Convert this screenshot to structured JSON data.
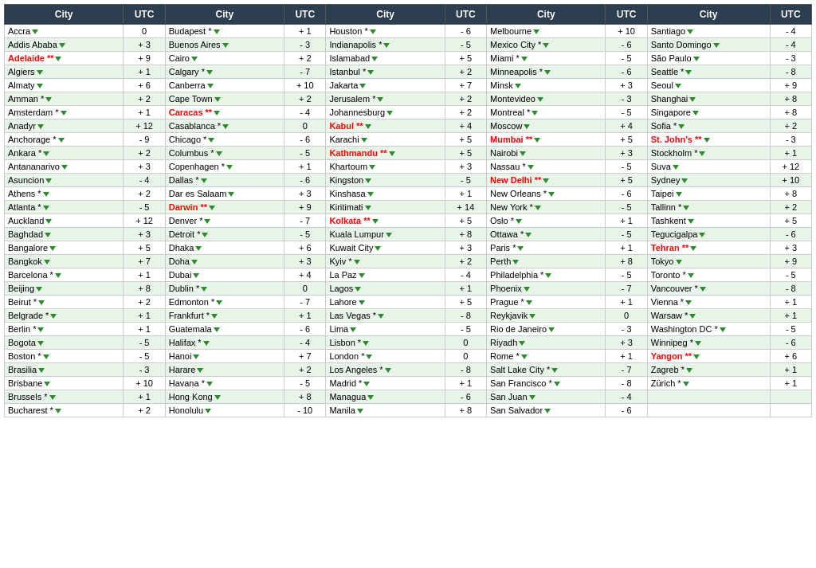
{
  "headers": [
    {
      "col1": "City",
      "col2": "UTC",
      "col3": "City",
      "col4": "UTC",
      "col5": "City",
      "col6": "UTC",
      "col7": "City",
      "col8": "UTC",
      "col9": "City",
      "col10": "UTC"
    }
  ],
  "rows": [
    [
      {
        "name": "Accra",
        "utc": "0",
        "red": false
      },
      {
        "name": "Budapest *",
        "utc": "+ 1",
        "red": false
      },
      {
        "name": "Houston *",
        "utc": "- 6",
        "red": false
      },
      {
        "name": "Melbourne",
        "utc": "+ 10",
        "red": false
      },
      {
        "name": "Santiago",
        "utc": "- 4",
        "red": false
      }
    ],
    [
      {
        "name": "Addis Ababa",
        "utc": "+ 3",
        "red": false
      },
      {
        "name": "Buenos Aires",
        "utc": "- 3",
        "red": false
      },
      {
        "name": "Indianapolis *",
        "utc": "- 5",
        "red": false
      },
      {
        "name": "Mexico City *",
        "utc": "- 6",
        "red": false
      },
      {
        "name": "Santo Domingo",
        "utc": "- 4",
        "red": false
      }
    ],
    [
      {
        "name": "Adelaide **",
        "utc": "+ 9",
        "red": true
      },
      {
        "name": "Cairo",
        "utc": "+ 2",
        "red": false
      },
      {
        "name": "Islamabad",
        "utc": "+ 5",
        "red": false
      },
      {
        "name": "Miami *",
        "utc": "- 5",
        "red": false
      },
      {
        "name": "São Paulo",
        "utc": "- 3",
        "red": false
      }
    ],
    [
      {
        "name": "Algiers",
        "utc": "+ 1",
        "red": false
      },
      {
        "name": "Calgary *",
        "utc": "- 7",
        "red": false
      },
      {
        "name": "Istanbul *",
        "utc": "+ 2",
        "red": false
      },
      {
        "name": "Minneapolis *",
        "utc": "- 6",
        "red": false
      },
      {
        "name": "Seattle *",
        "utc": "- 8",
        "red": false
      }
    ],
    [
      {
        "name": "Almaty",
        "utc": "+ 6",
        "red": false
      },
      {
        "name": "Canberra",
        "utc": "+ 10",
        "red": false
      },
      {
        "name": "Jakarta",
        "utc": "+ 7",
        "red": false
      },
      {
        "name": "Minsk",
        "utc": "+ 3",
        "red": false
      },
      {
        "name": "Seoul",
        "utc": "+ 9",
        "red": false
      }
    ],
    [
      {
        "name": "Amman *",
        "utc": "+ 2",
        "red": false
      },
      {
        "name": "Cape Town",
        "utc": "+ 2",
        "red": false
      },
      {
        "name": "Jerusalem *",
        "utc": "+ 2",
        "red": false
      },
      {
        "name": "Montevideo",
        "utc": "- 3",
        "red": false
      },
      {
        "name": "Shanghai",
        "utc": "+ 8",
        "red": false
      }
    ],
    [
      {
        "name": "Amsterdam *",
        "utc": "+ 1",
        "red": false
      },
      {
        "name": "Caracas **",
        "utc": "- 4",
        "red": true
      },
      {
        "name": "Johannesburg",
        "utc": "+ 2",
        "red": false
      },
      {
        "name": "Montreal *",
        "utc": "- 5",
        "red": false
      },
      {
        "name": "Singapore",
        "utc": "+ 8",
        "red": false
      }
    ],
    [
      {
        "name": "Anadyr",
        "utc": "+ 12",
        "red": false
      },
      {
        "name": "Casablanca *",
        "utc": "0",
        "red": false
      },
      {
        "name": "Kabul **",
        "utc": "+ 4",
        "red": true
      },
      {
        "name": "Moscow",
        "utc": "+ 4",
        "red": false
      },
      {
        "name": "Sofia *",
        "utc": "+ 2",
        "red": false
      }
    ],
    [
      {
        "name": "Anchorage *",
        "utc": "- 9",
        "red": false
      },
      {
        "name": "Chicago *",
        "utc": "- 6",
        "red": false
      },
      {
        "name": "Karachi",
        "utc": "+ 5",
        "red": false
      },
      {
        "name": "Mumbai **",
        "utc": "+ 5",
        "red": true
      },
      {
        "name": "St. John's **",
        "utc": "- 3",
        "red": true
      }
    ],
    [
      {
        "name": "Ankara *",
        "utc": "+ 2",
        "red": false
      },
      {
        "name": "Columbus *",
        "utc": "- 5",
        "red": false
      },
      {
        "name": "Kathmandu **",
        "utc": "+ 5",
        "red": true
      },
      {
        "name": "Nairobi",
        "utc": "+ 3",
        "red": false
      },
      {
        "name": "Stockholm *",
        "utc": "+ 1",
        "red": false
      }
    ],
    [
      {
        "name": "Antananarivo",
        "utc": "+ 3",
        "red": false
      },
      {
        "name": "Copenhagen *",
        "utc": "+ 1",
        "red": false
      },
      {
        "name": "Khartoum",
        "utc": "+ 3",
        "red": false
      },
      {
        "name": "Nassau *",
        "utc": "- 5",
        "red": false
      },
      {
        "name": "Suva",
        "utc": "+ 12",
        "red": false
      }
    ],
    [
      {
        "name": "Asuncion",
        "utc": "- 4",
        "red": false
      },
      {
        "name": "Dallas *",
        "utc": "- 6",
        "red": false
      },
      {
        "name": "Kingston",
        "utc": "- 5",
        "red": false
      },
      {
        "name": "New Delhi **",
        "utc": "+ 5",
        "red": true
      },
      {
        "name": "Sydney",
        "utc": "+ 10",
        "red": false
      }
    ],
    [
      {
        "name": "Athens *",
        "utc": "+ 2",
        "red": false
      },
      {
        "name": "Dar es Salaam",
        "utc": "+ 3",
        "red": false
      },
      {
        "name": "Kinshasa",
        "utc": "+ 1",
        "red": false
      },
      {
        "name": "New Orleans *",
        "utc": "- 6",
        "red": false
      },
      {
        "name": "Taipei",
        "utc": "+ 8",
        "red": false
      }
    ],
    [
      {
        "name": "Atlanta *",
        "utc": "- 5",
        "red": false
      },
      {
        "name": "Darwin **",
        "utc": "+ 9",
        "red": true
      },
      {
        "name": "Kiritimati",
        "utc": "+ 14",
        "red": false
      },
      {
        "name": "New York *",
        "utc": "- 5",
        "red": false
      },
      {
        "name": "Tallinn *",
        "utc": "+ 2",
        "red": false
      }
    ],
    [
      {
        "name": "Auckland",
        "utc": "+ 12",
        "red": false
      },
      {
        "name": "Denver *",
        "utc": "- 7",
        "red": false
      },
      {
        "name": "Kolkata **",
        "utc": "+ 5",
        "red": true
      },
      {
        "name": "Oslo *",
        "utc": "+ 1",
        "red": false
      },
      {
        "name": "Tashkent",
        "utc": "+ 5",
        "red": false
      }
    ],
    [
      {
        "name": "Baghdad",
        "utc": "+ 3",
        "red": false
      },
      {
        "name": "Detroit *",
        "utc": "- 5",
        "red": false
      },
      {
        "name": "Kuala Lumpur",
        "utc": "+ 8",
        "red": false
      },
      {
        "name": "Ottawa *",
        "utc": "- 5",
        "red": false
      },
      {
        "name": "Tegucigalpa",
        "utc": "- 6",
        "red": false
      }
    ],
    [
      {
        "name": "Bangalore",
        "utc": "+ 5",
        "red": false
      },
      {
        "name": "Dhaka",
        "utc": "+ 6",
        "red": false
      },
      {
        "name": "Kuwait City",
        "utc": "+ 3",
        "red": false
      },
      {
        "name": "Paris *",
        "utc": "+ 1",
        "red": false
      },
      {
        "name": "Tehran **",
        "utc": "+ 3",
        "red": true
      }
    ],
    [
      {
        "name": "Bangkok",
        "utc": "+ 7",
        "red": false
      },
      {
        "name": "Doha",
        "utc": "+ 3",
        "red": false
      },
      {
        "name": "Kyiv *",
        "utc": "+ 2",
        "red": false
      },
      {
        "name": "Perth",
        "utc": "+ 8",
        "red": false
      },
      {
        "name": "Tokyo",
        "utc": "+ 9",
        "red": false
      }
    ],
    [
      {
        "name": "Barcelona *",
        "utc": "+ 1",
        "red": false
      },
      {
        "name": "Dubai",
        "utc": "+ 4",
        "red": false
      },
      {
        "name": "La Paz",
        "utc": "- 4",
        "red": false
      },
      {
        "name": "Philadelphia *",
        "utc": "- 5",
        "red": false
      },
      {
        "name": "Toronto *",
        "utc": "- 5",
        "red": false
      }
    ],
    [
      {
        "name": "Beijing",
        "utc": "+ 8",
        "red": false
      },
      {
        "name": "Dublin *",
        "utc": "0",
        "red": false
      },
      {
        "name": "Lagos",
        "utc": "+ 1",
        "red": false
      },
      {
        "name": "Phoenix",
        "utc": "- 7",
        "red": false
      },
      {
        "name": "Vancouver *",
        "utc": "- 8",
        "red": false
      }
    ],
    [
      {
        "name": "Beirut *",
        "utc": "+ 2",
        "red": false
      },
      {
        "name": "Edmonton *",
        "utc": "- 7",
        "red": false
      },
      {
        "name": "Lahore",
        "utc": "+ 5",
        "red": false
      },
      {
        "name": "Prague *",
        "utc": "+ 1",
        "red": false
      },
      {
        "name": "Vienna *",
        "utc": "+ 1",
        "red": false
      }
    ],
    [
      {
        "name": "Belgrade *",
        "utc": "+ 1",
        "red": false
      },
      {
        "name": "Frankfurt *",
        "utc": "+ 1",
        "red": false
      },
      {
        "name": "Las Vegas *",
        "utc": "- 8",
        "red": false
      },
      {
        "name": "Reykjavik",
        "utc": "0",
        "red": false
      },
      {
        "name": "Warsaw *",
        "utc": "+ 1",
        "red": false
      }
    ],
    [
      {
        "name": "Berlin *",
        "utc": "+ 1",
        "red": false
      },
      {
        "name": "Guatemala",
        "utc": "- 6",
        "red": false
      },
      {
        "name": "Lima",
        "utc": "- 5",
        "red": false
      },
      {
        "name": "Rio de Janeiro",
        "utc": "- 3",
        "red": false
      },
      {
        "name": "Washington DC *",
        "utc": "- 5",
        "red": false
      }
    ],
    [
      {
        "name": "Bogota",
        "utc": "- 5",
        "red": false
      },
      {
        "name": "Halifax *",
        "utc": "- 4",
        "red": false
      },
      {
        "name": "Lisbon *",
        "utc": "0",
        "red": false
      },
      {
        "name": "Riyadh",
        "utc": "+ 3",
        "red": false
      },
      {
        "name": "Winnipeg *",
        "utc": "- 6",
        "red": false
      }
    ],
    [
      {
        "name": "Boston *",
        "utc": "- 5",
        "red": false
      },
      {
        "name": "Hanoi",
        "utc": "+ 7",
        "red": false
      },
      {
        "name": "London *",
        "utc": "0",
        "red": false
      },
      {
        "name": "Rome *",
        "utc": "+ 1",
        "red": false
      },
      {
        "name": "Yangon **",
        "utc": "+ 6",
        "red": true
      }
    ],
    [
      {
        "name": "Brasilia",
        "utc": "- 3",
        "red": false
      },
      {
        "name": "Harare",
        "utc": "+ 2",
        "red": false
      },
      {
        "name": "Los Angeles *",
        "utc": "- 8",
        "red": false
      },
      {
        "name": "Salt Lake City *",
        "utc": "- 7",
        "red": false
      },
      {
        "name": "Zagreb *",
        "utc": "+ 1",
        "red": false
      }
    ],
    [
      {
        "name": "Brisbane",
        "utc": "+ 10",
        "red": false
      },
      {
        "name": "Havana *",
        "utc": "- 5",
        "red": false
      },
      {
        "name": "Madrid *",
        "utc": "+ 1",
        "red": false
      },
      {
        "name": "San Francisco *",
        "utc": "- 8",
        "red": false
      },
      {
        "name": "Zürich *",
        "utc": "+ 1",
        "red": false
      }
    ],
    [
      {
        "name": "Brussels *",
        "utc": "+ 1",
        "red": false
      },
      {
        "name": "Hong Kong",
        "utc": "+ 8",
        "red": false
      },
      {
        "name": "Managua",
        "utc": "- 6",
        "red": false
      },
      {
        "name": "San Juan",
        "utc": "- 4",
        "red": false
      },
      {
        "name": "",
        "utc": "",
        "red": false
      }
    ],
    [
      {
        "name": "Bucharest *",
        "utc": "+ 2",
        "red": false
      },
      {
        "name": "Honolulu",
        "utc": "- 10",
        "red": false
      },
      {
        "name": "Manila",
        "utc": "+ 8",
        "red": false
      },
      {
        "name": "San Salvador",
        "utc": "- 6",
        "red": false
      },
      {
        "name": "",
        "utc": "",
        "red": false
      }
    ]
  ]
}
